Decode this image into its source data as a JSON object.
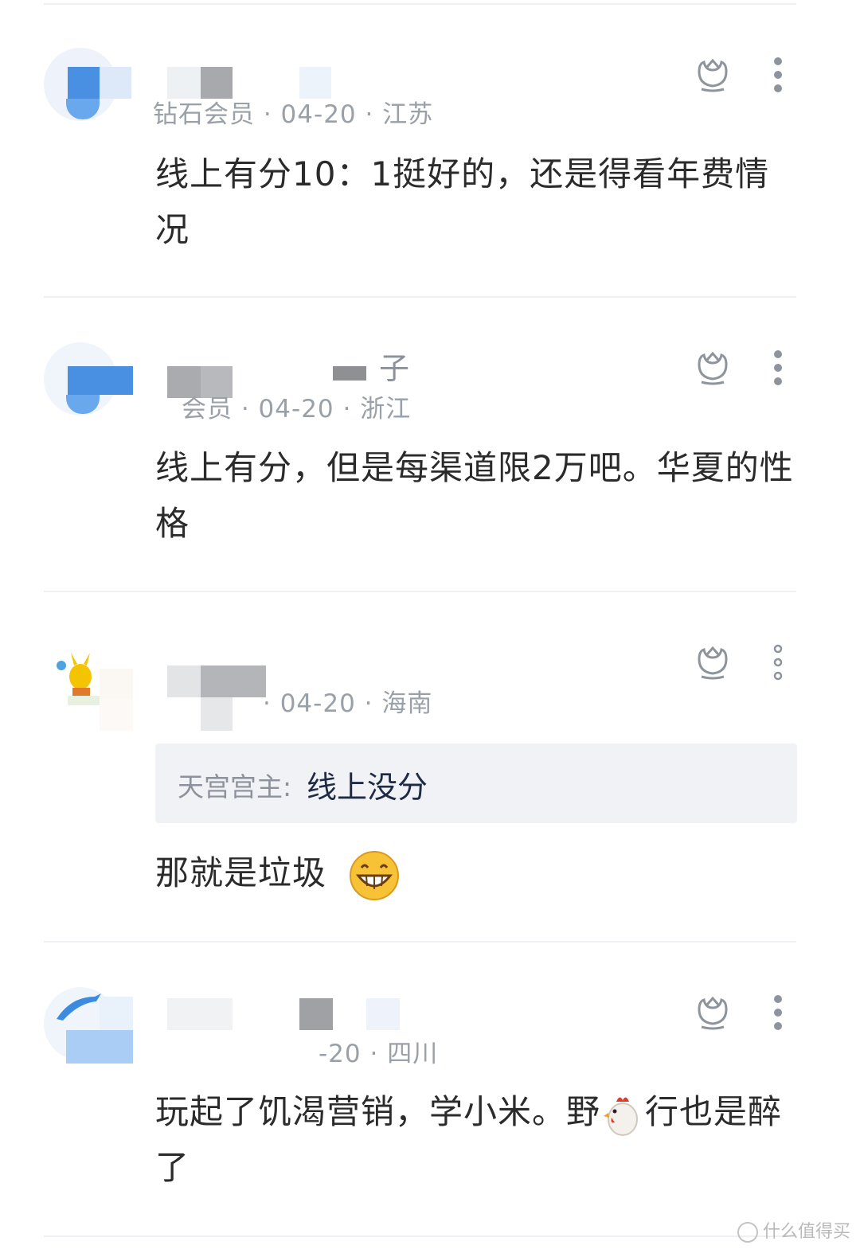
{
  "comments": [
    {
      "username": "",
      "meta": "钻石会员 · 04-20 · 江苏",
      "text": "线上有分10：1挺好的，还是得看年费情况"
    },
    {
      "username": "子",
      "meta": "会员 · 04-20 · 浙江",
      "text": "线上有分，但是每渠道限2万吧。华夏的性格"
    },
    {
      "username": "",
      "meta": "· 04-20 · 海南",
      "quote_name": "天宫宫主:",
      "quote_text": "线上没分",
      "text": "那就是垃圾"
    },
    {
      "username": "",
      "meta": "-20 · 四川",
      "text_before": "玩起了饥渴营销，学小米。野",
      "text_after": "行也是醉了"
    }
  ],
  "icons": {
    "like": "like-icon",
    "more": "more-vertical-icon",
    "grin": "grinning-emoji",
    "chicken": "chicken-emoji"
  },
  "watermark": "什么值得买",
  "colors": {
    "meta": "#9aa0a8",
    "quote_bg": "#f1f2f5",
    "divider": "#eef0f3"
  }
}
